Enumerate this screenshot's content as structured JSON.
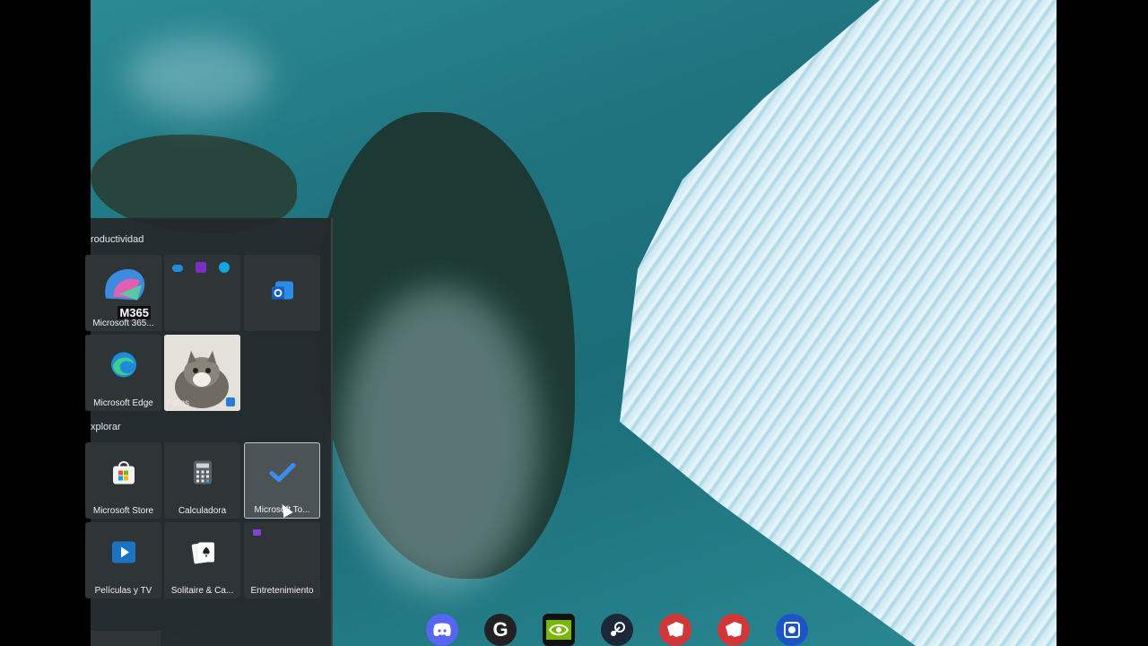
{
  "start_menu": {
    "sections": [
      {
        "label": "roductividad",
        "tiles": [
          {
            "label": "Microsoft 365...",
            "badge": "M365",
            "icon": "microsoft-365-icon"
          },
          {
            "label": "",
            "icon": "office-apps-folder-icon"
          },
          {
            "label": "",
            "icon": "outlook-icon"
          },
          {
            "label": "Microsoft Edge",
            "icon": "edge-icon"
          },
          {
            "label": "Fotos",
            "icon": "photos-cat-thumbnail"
          }
        ]
      },
      {
        "label": "xplorar",
        "tiles": [
          {
            "label": "Microsoft Store",
            "icon": "store-icon"
          },
          {
            "label": "Calculadora",
            "icon": "calculator-icon"
          },
          {
            "label": "Microsoft To...",
            "icon": "todo-check-icon"
          },
          {
            "label": "Películas y TV",
            "icon": "movies-play-icon"
          },
          {
            "label": "Solitaire & Ca...",
            "icon": "cards-icon"
          },
          {
            "label": "Entretenimiento",
            "icon": "entertainment-folder-icon"
          }
        ]
      }
    ]
  },
  "taskbar": {
    "icons": [
      {
        "name": "discord-icon",
        "color": "#5865f2"
      },
      {
        "name": "logitech-g-icon",
        "color": "#222222"
      },
      {
        "name": "nvidia-icon",
        "color": "#111111"
      },
      {
        "name": "steam-icon",
        "color": "#1b2838"
      },
      {
        "name": "riot-client-icon",
        "color": "#d13639"
      },
      {
        "name": "riot-games-icon",
        "color": "#d13639"
      },
      {
        "name": "snipping-tool-icon",
        "color": "#1a55c8"
      }
    ]
  }
}
